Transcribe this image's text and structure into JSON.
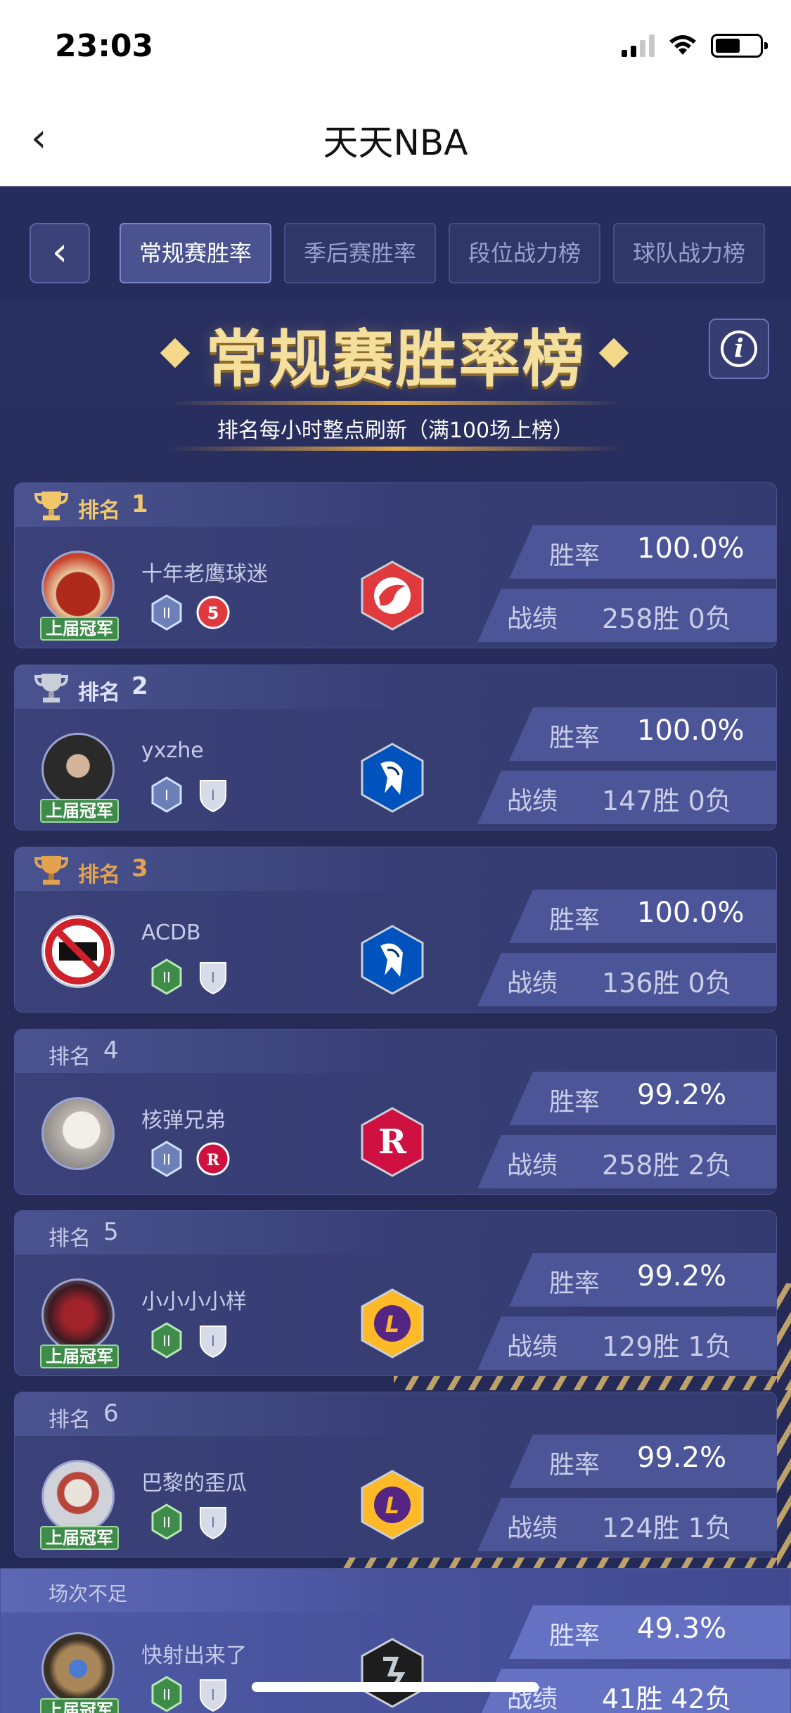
{
  "status_bar": {
    "time": "23:03"
  },
  "nav": {
    "back": "‹",
    "title": "天天NBA"
  },
  "tabs": {
    "back": "‹",
    "items": [
      {
        "label": "常规赛胜率",
        "active": true
      },
      {
        "label": "季后赛胜率",
        "active": false
      },
      {
        "label": "段位战力榜",
        "active": false
      },
      {
        "label": "球队战力榜",
        "active": false
      }
    ]
  },
  "header": {
    "title": "常规赛胜率榜",
    "info": "i",
    "subtitle": "排名每小时整点刷新（满100场上榜）"
  },
  "labels": {
    "rank": "排名",
    "win_rate": "胜率",
    "record": "战绩",
    "champion_tag": "上届冠军"
  },
  "entries": [
    {
      "rank": "1",
      "name": "十年老鹰球迷",
      "win_rate": "100.0%",
      "record": "258胜 0负",
      "team": "hawks-logo",
      "champion": true
    },
    {
      "rank": "2",
      "name": "yxzhe",
      "win_rate": "100.0%",
      "record": "147胜 0负",
      "team": "mavericks-logo",
      "champion": true
    },
    {
      "rank": "3",
      "name": "ACDB",
      "win_rate": "100.0%",
      "record": "136胜 0负",
      "team": "mavericks-logo",
      "champion": false
    },
    {
      "rank": "4",
      "name": "核弹兄弟",
      "win_rate": "99.2%",
      "record": "258胜 2负",
      "team": "rockets-logo",
      "champion": false
    },
    {
      "rank": "5",
      "name": "小小小小样",
      "win_rate": "99.2%",
      "record": "129胜 1负",
      "team": "lakers-logo",
      "champion": true
    },
    {
      "rank": "6",
      "name": "巴黎的歪瓜",
      "win_rate": "99.2%",
      "record": "124胜 1负",
      "team": "lakers-logo",
      "champion": true
    }
  ],
  "self_entry": {
    "rank_label": "场次不足",
    "name": "快射出来了",
    "win_rate": "49.3%",
    "record": "41胜 42负",
    "team": "spurs-logo",
    "champion": true
  },
  "colors": {
    "gold": "#f1c76a",
    "silver": "#c9ced8",
    "bronze": "#e2a24e",
    "bg": "#262b58"
  }
}
